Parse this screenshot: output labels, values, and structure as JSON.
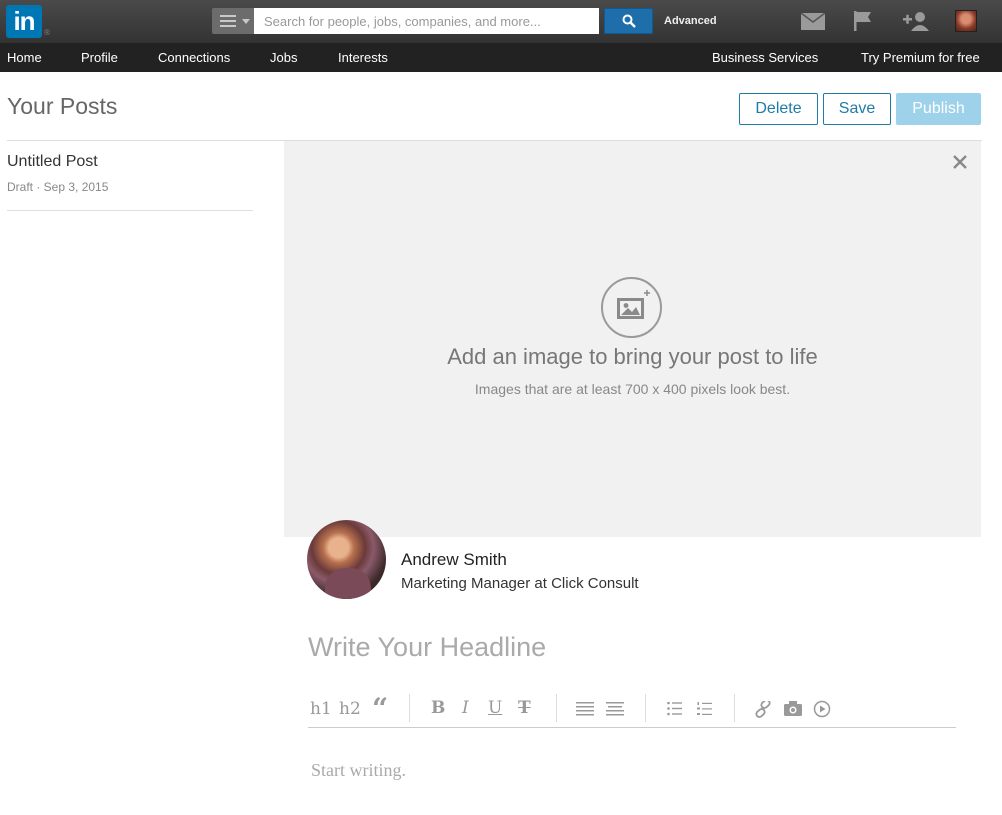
{
  "brand": {
    "logo_text": "in",
    "logo_mark": "®"
  },
  "search": {
    "placeholder": "Search for people, jobs, companies, and more...",
    "advanced_label": "Advanced"
  },
  "topbar_icons": [
    "mail-icon",
    "flag-icon",
    "add-connection-icon",
    "profile-avatar"
  ],
  "nav": {
    "items": [
      "Home",
      "Profile",
      "Connections",
      "Jobs",
      "Interests"
    ],
    "business": "Business Services",
    "premium": "Try Premium for free"
  },
  "header": {
    "title": "Your Posts",
    "delete_label": "Delete",
    "save_label": "Save",
    "publish_label": "Publish"
  },
  "posts": [
    {
      "title": "Untitled Post",
      "meta": "Draft · Sep 3, 2015"
    }
  ],
  "image_prompt": {
    "heading": "Add an image to bring your post to life",
    "subtext": "Images that are at least 700 x 400 pixels look best."
  },
  "author": {
    "name": "Andrew Smith",
    "role": "Marketing Manager at Click Consult"
  },
  "editor": {
    "headline_placeholder": "Write Your Headline",
    "body_placeholder": "Start writing.",
    "toolbar": {
      "h1": "h1",
      "h2": "h2",
      "quote": "“",
      "bold": "B",
      "italic": "I",
      "underline": "U",
      "strike": "T"
    }
  },
  "colors": {
    "accent": "#0077b5",
    "button_border": "#1f7ba7",
    "publish_disabled": "#9dd2ea",
    "topbar": "#3a3a3a",
    "navbar": "#222222",
    "image_area": "#f1f1f1"
  }
}
